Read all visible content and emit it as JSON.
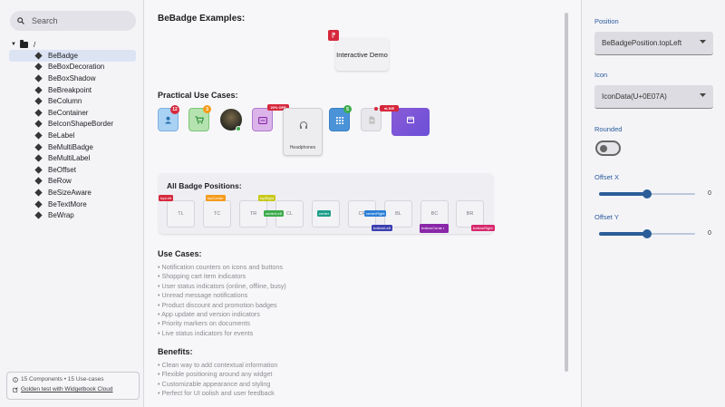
{
  "sidebar": {
    "search_placeholder": "Search",
    "root_label": "/",
    "items": [
      "BeBadge",
      "BeBoxDecoration",
      "BeBoxShadow",
      "BeBreakpoint",
      "BeColumn",
      "BeContainer",
      "BeIconShapeBorder",
      "BeLabel",
      "BeMultiBadge",
      "BeMultiLabel",
      "BeOffset",
      "BeRow",
      "BeSizeAware",
      "BeTextMore",
      "BeWrap"
    ],
    "selected_index": 0,
    "footer_info": "15 Components • 15 Use-cases",
    "footer_link": "Golden test with Widgetbook Cloud"
  },
  "main": {
    "title": "BeBadge Examples:",
    "demo_label": "Interactive Demo",
    "practical_title": "Practical Use Cases:",
    "practical_badges": {
      "count_12": "12",
      "count_3": "3",
      "discount": "20% OFF",
      "count_5": "5",
      "live": "LIVE"
    },
    "headphones_label": "Headphones",
    "positions_title": "All Badge Positions:",
    "positions": [
      "TL",
      "TC",
      "TR",
      "CL",
      "C",
      "CR",
      "BL",
      "BC",
      "BR"
    ],
    "position_tags": {
      "topLeft": "topLeft",
      "topCenter": "topCenter",
      "topRight": "topRight",
      "centerLeft": "centerLeft",
      "center": "center",
      "centerRight": "centerRight",
      "bottomLeft": "bottomLeft",
      "bottomCenter": "bottomCente r",
      "bottomRight": "bottomRight"
    },
    "use_cases_title": "Use Cases:",
    "use_cases": [
      "• Notification counters on icons and buttons",
      "• Shopping cart item indicators",
      "• User status indicators (online, offline, busy)",
      "• Unread message notifications",
      "• Product discount and promotion badges",
      "• App update and version indicators",
      "• Priority markers on documents",
      "• Live status indicators for events"
    ],
    "benefits_title": "Benefits:",
    "benefits": [
      "• Clean way to add contextual information",
      "• Flexible positioning around any widget",
      "• Customizable appearance and styling",
      "• Perfect for UI polish and user feedback"
    ]
  },
  "knobs": {
    "position_label": "Position",
    "position_value": "BeBadgePosition.topLeft",
    "icon_label": "Icon",
    "icon_value": "IconData(U+0E07A)",
    "rounded_label": "Rounded",
    "rounded_value": false,
    "offset_x_label": "Offset X",
    "offset_x_value": "0",
    "offset_y_label": "Offset Y",
    "offset_y_value": "0",
    "slider_fraction": 0.5
  },
  "colors": {
    "accent": "#2b5d98",
    "badge_red": "#d6283c",
    "badge_orange": "#f59b1a",
    "badge_green": "#3cab4c",
    "badge_purple": "#8a27a8",
    "badge_indigo": "#3b3fb0",
    "badge_pink": "#d6286c"
  }
}
